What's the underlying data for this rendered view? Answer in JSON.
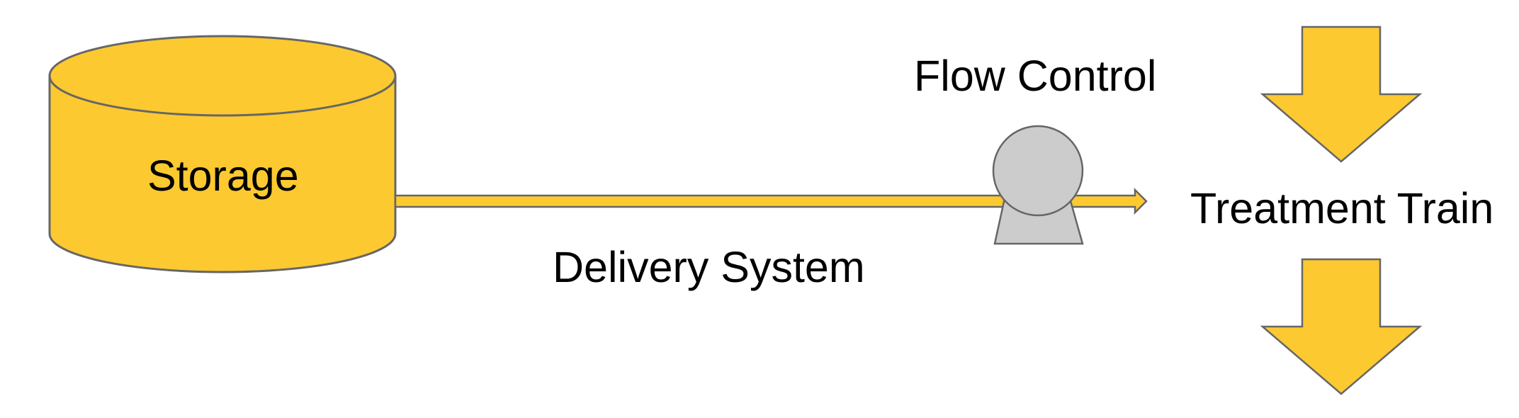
{
  "diagram": {
    "storage": {
      "label": "Storage"
    },
    "flow_control": {
      "label": "Flow Control"
    },
    "delivery_system": {
      "label": "Delivery System"
    },
    "treatment_train": {
      "label": "Treatment Train"
    },
    "colors": {
      "fill_primary": "#fcc930",
      "fill_pump": "#cccccc",
      "stroke": "#666666",
      "text": "#000000",
      "background": "#ffffff"
    }
  }
}
